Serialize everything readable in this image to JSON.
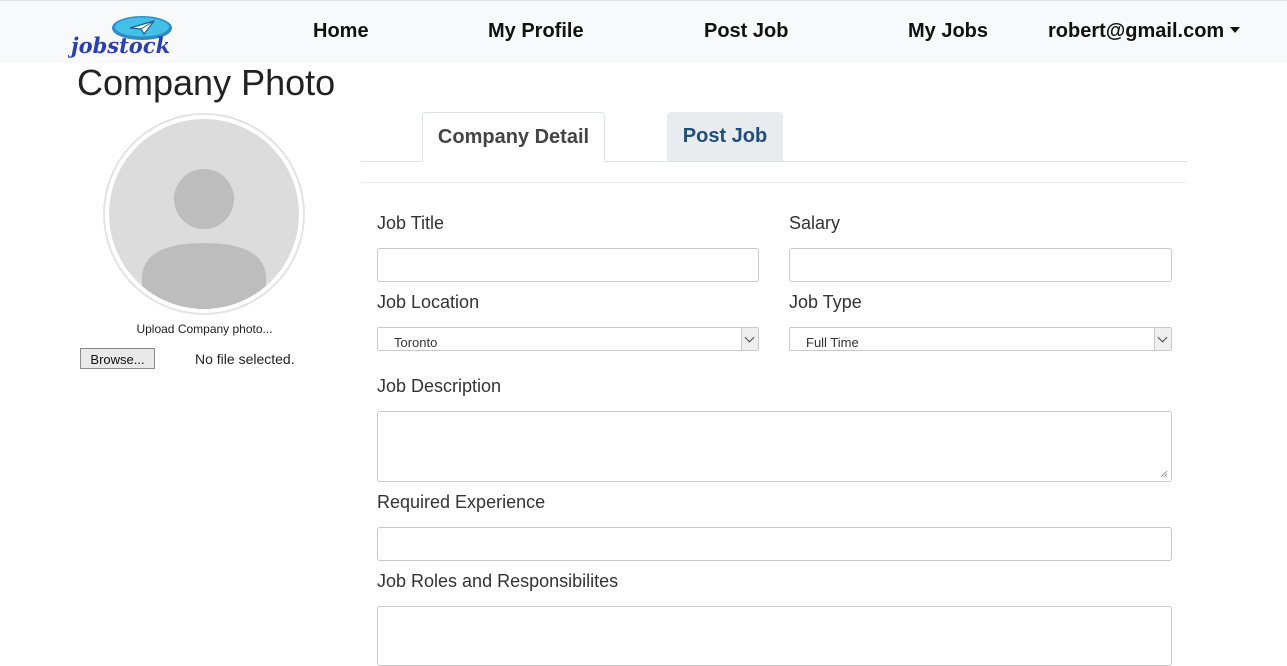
{
  "brand": {
    "logo_text": "jobstock",
    "accent": "#2a3fb0",
    "bubble": "#3da5d9"
  },
  "nav": {
    "home": "Home",
    "profile": "My Profile",
    "post_job": "Post Job",
    "my_jobs": "My Jobs",
    "user": "robert@gmail.com"
  },
  "sidebar": {
    "title": "Company Photo",
    "upload_label": "Upload Company photo...",
    "browse_label": "Browse...",
    "file_status": "No file selected."
  },
  "tabs": {
    "company_detail": "Company Detail",
    "post_job": "Post Job"
  },
  "form": {
    "job_title_label": "Job Title",
    "job_title_value": "",
    "salary_label": "Salary",
    "salary_value": "",
    "location_label": "Job Location",
    "location_value": "Toronto",
    "type_label": "Job Type",
    "type_value": "Full Time",
    "description_label": "Job Description",
    "experience_label": "Required Experience",
    "roles_label": "Job Roles and Responsibilites"
  },
  "colors": {
    "navbar_bg": "#f8f9fa",
    "tab_active_text": "#444444",
    "tab_inactive_text": "#1f4e79",
    "tab_inactive_bg": "#e9ecef"
  }
}
